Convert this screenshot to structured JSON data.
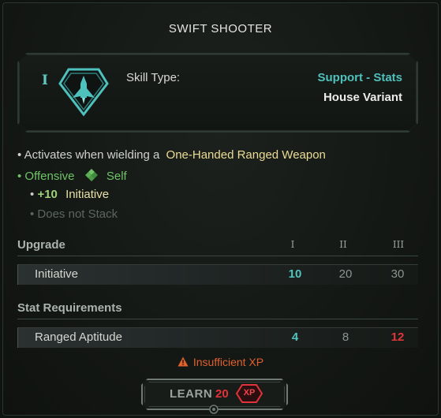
{
  "title": "SWIFT SHOOTER",
  "header": {
    "tier": "I",
    "skill_icon": "rocket-shield-icon",
    "skill_type_label": "Skill Type:",
    "skill_type_value": "Support - Stats",
    "variant": "House Variant"
  },
  "description": {
    "line1_prefix": "• Activates when wielding a",
    "line1_highlight": "One-Handed Ranged Weapon",
    "line2_prefix": "• Offensive",
    "line2_icon": "diamond-arrows-icon",
    "line2_target": "Self",
    "line3_bullet": "•",
    "line3_amount": "+10",
    "line3_stat": "Initiative",
    "line4": "• Does not Stack"
  },
  "upgrade": {
    "label": "Upgrade",
    "tiers": [
      "I",
      "II",
      "III"
    ],
    "rows": [
      {
        "label": "Initiative",
        "values": [
          "10",
          "20",
          "30"
        ]
      }
    ]
  },
  "requirements": {
    "label": "Stat Requirements",
    "rows": [
      {
        "label": "Ranged Aptitude",
        "values": [
          "4",
          "8",
          "12"
        ]
      }
    ]
  },
  "warning": {
    "icon": "warning-triangle-icon",
    "text": "Insufficient XP"
  },
  "learn_button": {
    "label": "LEARN",
    "cost": "20",
    "currency": "XP"
  },
  "colors": {
    "accent_teal": "#52c3bb",
    "highlight_yellow": "#ecdc96",
    "offensive_green": "#6fc268",
    "error_red": "#e0353a",
    "warning_orange": "#e0602e"
  }
}
